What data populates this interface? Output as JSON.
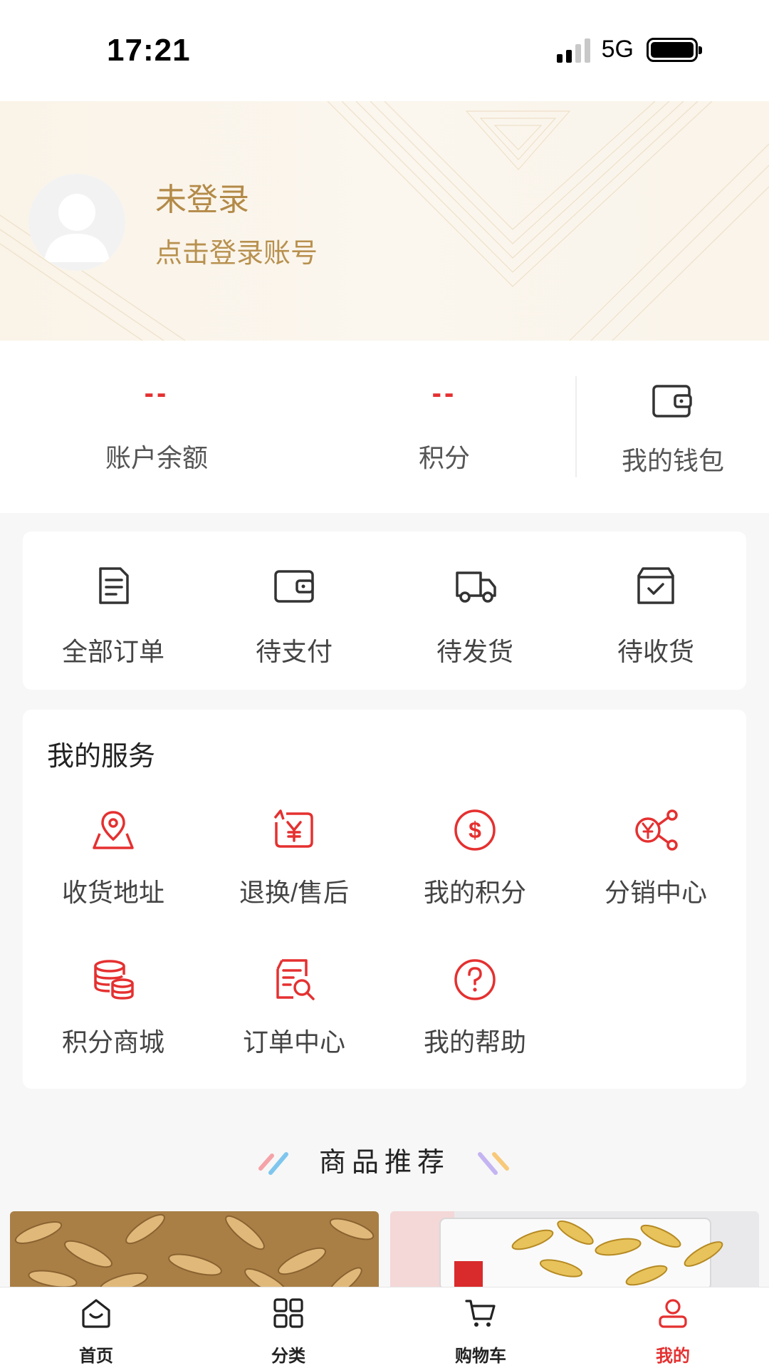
{
  "status_bar": {
    "time": "17:21",
    "network": "5G"
  },
  "profile": {
    "title": "未登录",
    "subtitle": "点击登录账号"
  },
  "stats": {
    "balance": {
      "value": "--",
      "label": "账户余额"
    },
    "points": {
      "value": "--",
      "label": "积分"
    },
    "wallet": {
      "label": "我的钱包",
      "icon": "wallet-icon"
    }
  },
  "orders": [
    {
      "label": "全部订单",
      "icon": "document-icon"
    },
    {
      "label": "待支付",
      "icon": "wallet-icon"
    },
    {
      "label": "待发货",
      "icon": "truck-icon"
    },
    {
      "label": "待收货",
      "icon": "box-check-icon"
    }
  ],
  "services": {
    "title": "我的服务",
    "items": [
      {
        "label": "收货地址",
        "icon": "map-pin-icon"
      },
      {
        "label": "退换/售后",
        "icon": "refund-icon"
      },
      {
        "label": "我的积分",
        "icon": "dollar-coin-icon"
      },
      {
        "label": "分销中心",
        "icon": "share-network-icon"
      },
      {
        "label": "积分商城",
        "icon": "coins-stack-icon"
      },
      {
        "label": "订单中心",
        "icon": "document-search-icon"
      },
      {
        "label": "我的帮助",
        "icon": "help-icon"
      }
    ]
  },
  "recommend": {
    "title": "商品推荐"
  },
  "tabs": [
    {
      "label": "首页",
      "icon": "home-icon"
    },
    {
      "label": "分类",
      "icon": "grid-icon"
    },
    {
      "label": "购物车",
      "icon": "cart-icon"
    },
    {
      "label": "我的",
      "icon": "user-icon",
      "active": true
    }
  ],
  "colors": {
    "accent": "#e53030",
    "gold": "#b38a47",
    "header_bg": "#faf3e8"
  }
}
